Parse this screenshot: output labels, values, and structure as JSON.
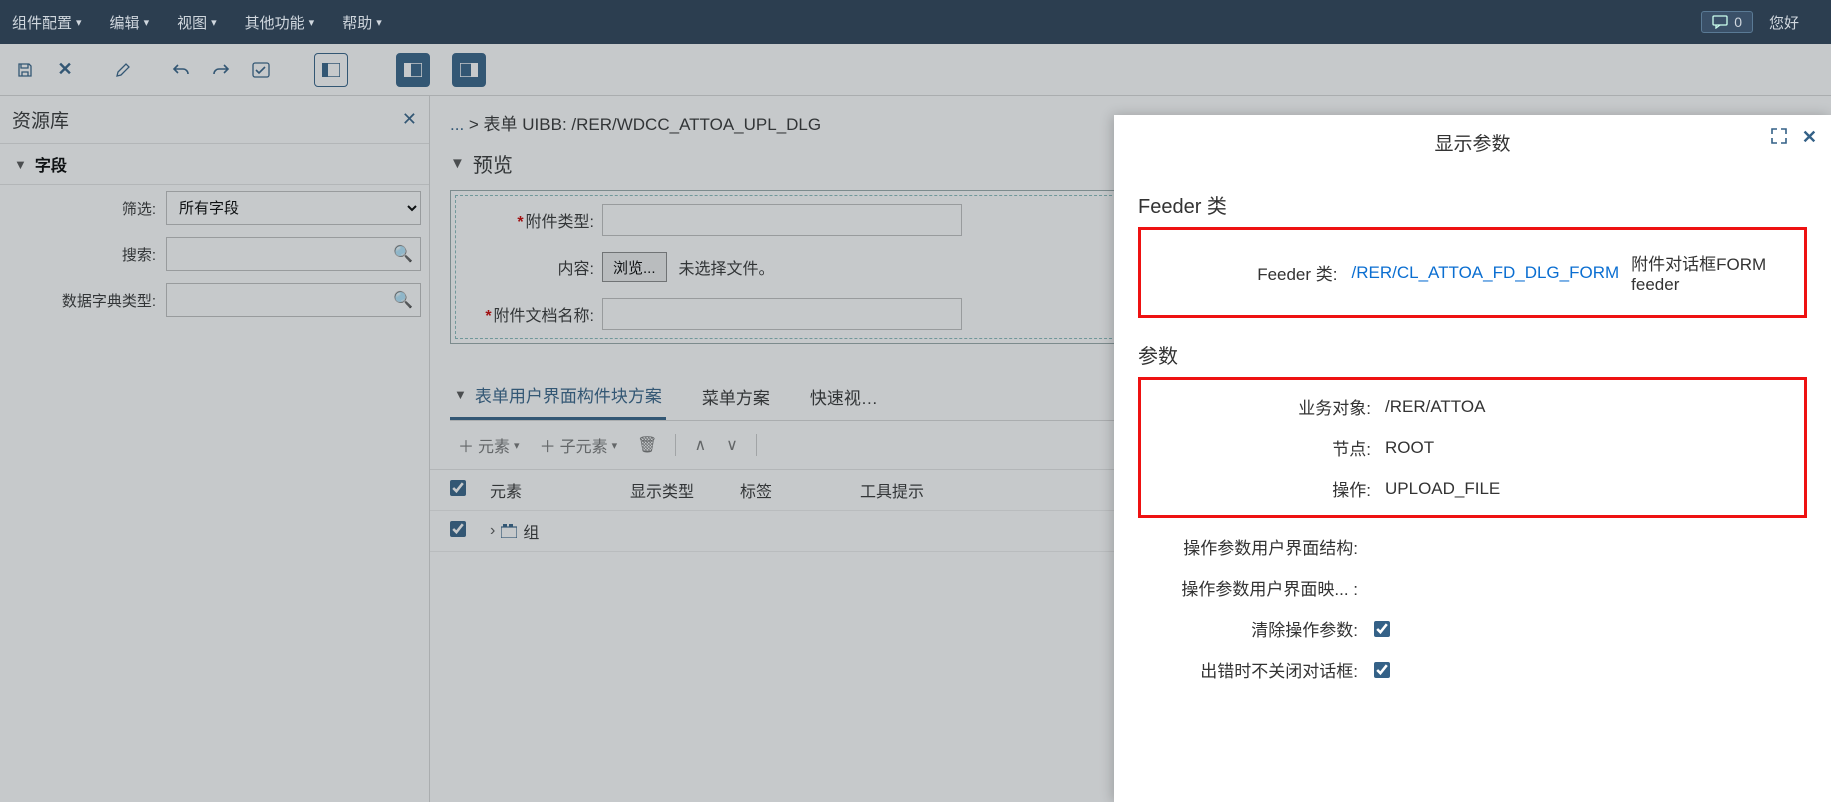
{
  "topbar": {
    "menus": [
      "组件配置",
      "编辑",
      "视图",
      "其他功能",
      "帮助"
    ],
    "notif_count": "0",
    "greeting": "您好"
  },
  "sidebar": {
    "title": "资源库",
    "section": "字段",
    "filter_label": "筛选:",
    "filter_value": "所有字段",
    "search_label": "搜索:",
    "ddic_label": "数据字典类型:"
  },
  "breadcrumb": {
    "prefix": "...",
    "sep": " > ",
    "text": "表单 UIBB: /RER/WDCC_ATTOA_UPL_DLG"
  },
  "preview": {
    "title": "预览",
    "rows": {
      "attach_type": "附件类型:",
      "content": "内容:",
      "browse": "浏览...",
      "no_file": "未选择文件。",
      "doc_name": "附件文档名称:"
    }
  },
  "tabs": {
    "t1": "表单用户界面构件块方案",
    "t2": "菜单方案",
    "t3": "快速视…"
  },
  "sub_toolbar": {
    "add_elem": "元素",
    "add_child": "子元素",
    "up": "∧",
    "down": "∨"
  },
  "table": {
    "h1": "元素",
    "h2": "显示类型",
    "h3": "标签",
    "h4": "工具提示",
    "row1": "组"
  },
  "popup": {
    "title": "显示参数",
    "feeder_section": "Feeder 类",
    "feeder_label": "Feeder 类:",
    "feeder_class": "/RER/CL_ATTOA_FD_DLG_FORM",
    "feeder_desc": "附件对话框FORM feeder",
    "params_section": "参数",
    "p_bo_label": "业务对象:",
    "p_bo_val": "/RER/ATTOA",
    "p_node_label": "节点:",
    "p_node_val": "ROOT",
    "p_op_label": "操作:",
    "p_op_val": "UPLOAD_FILE",
    "p_ui_struct_label": "操作参数用户界面结构:",
    "p_ui_map_label": "操作参数用户界面映...  :",
    "p_clear_label": "清除操作参数:",
    "p_err_label": "出错时不关闭对话框:"
  }
}
